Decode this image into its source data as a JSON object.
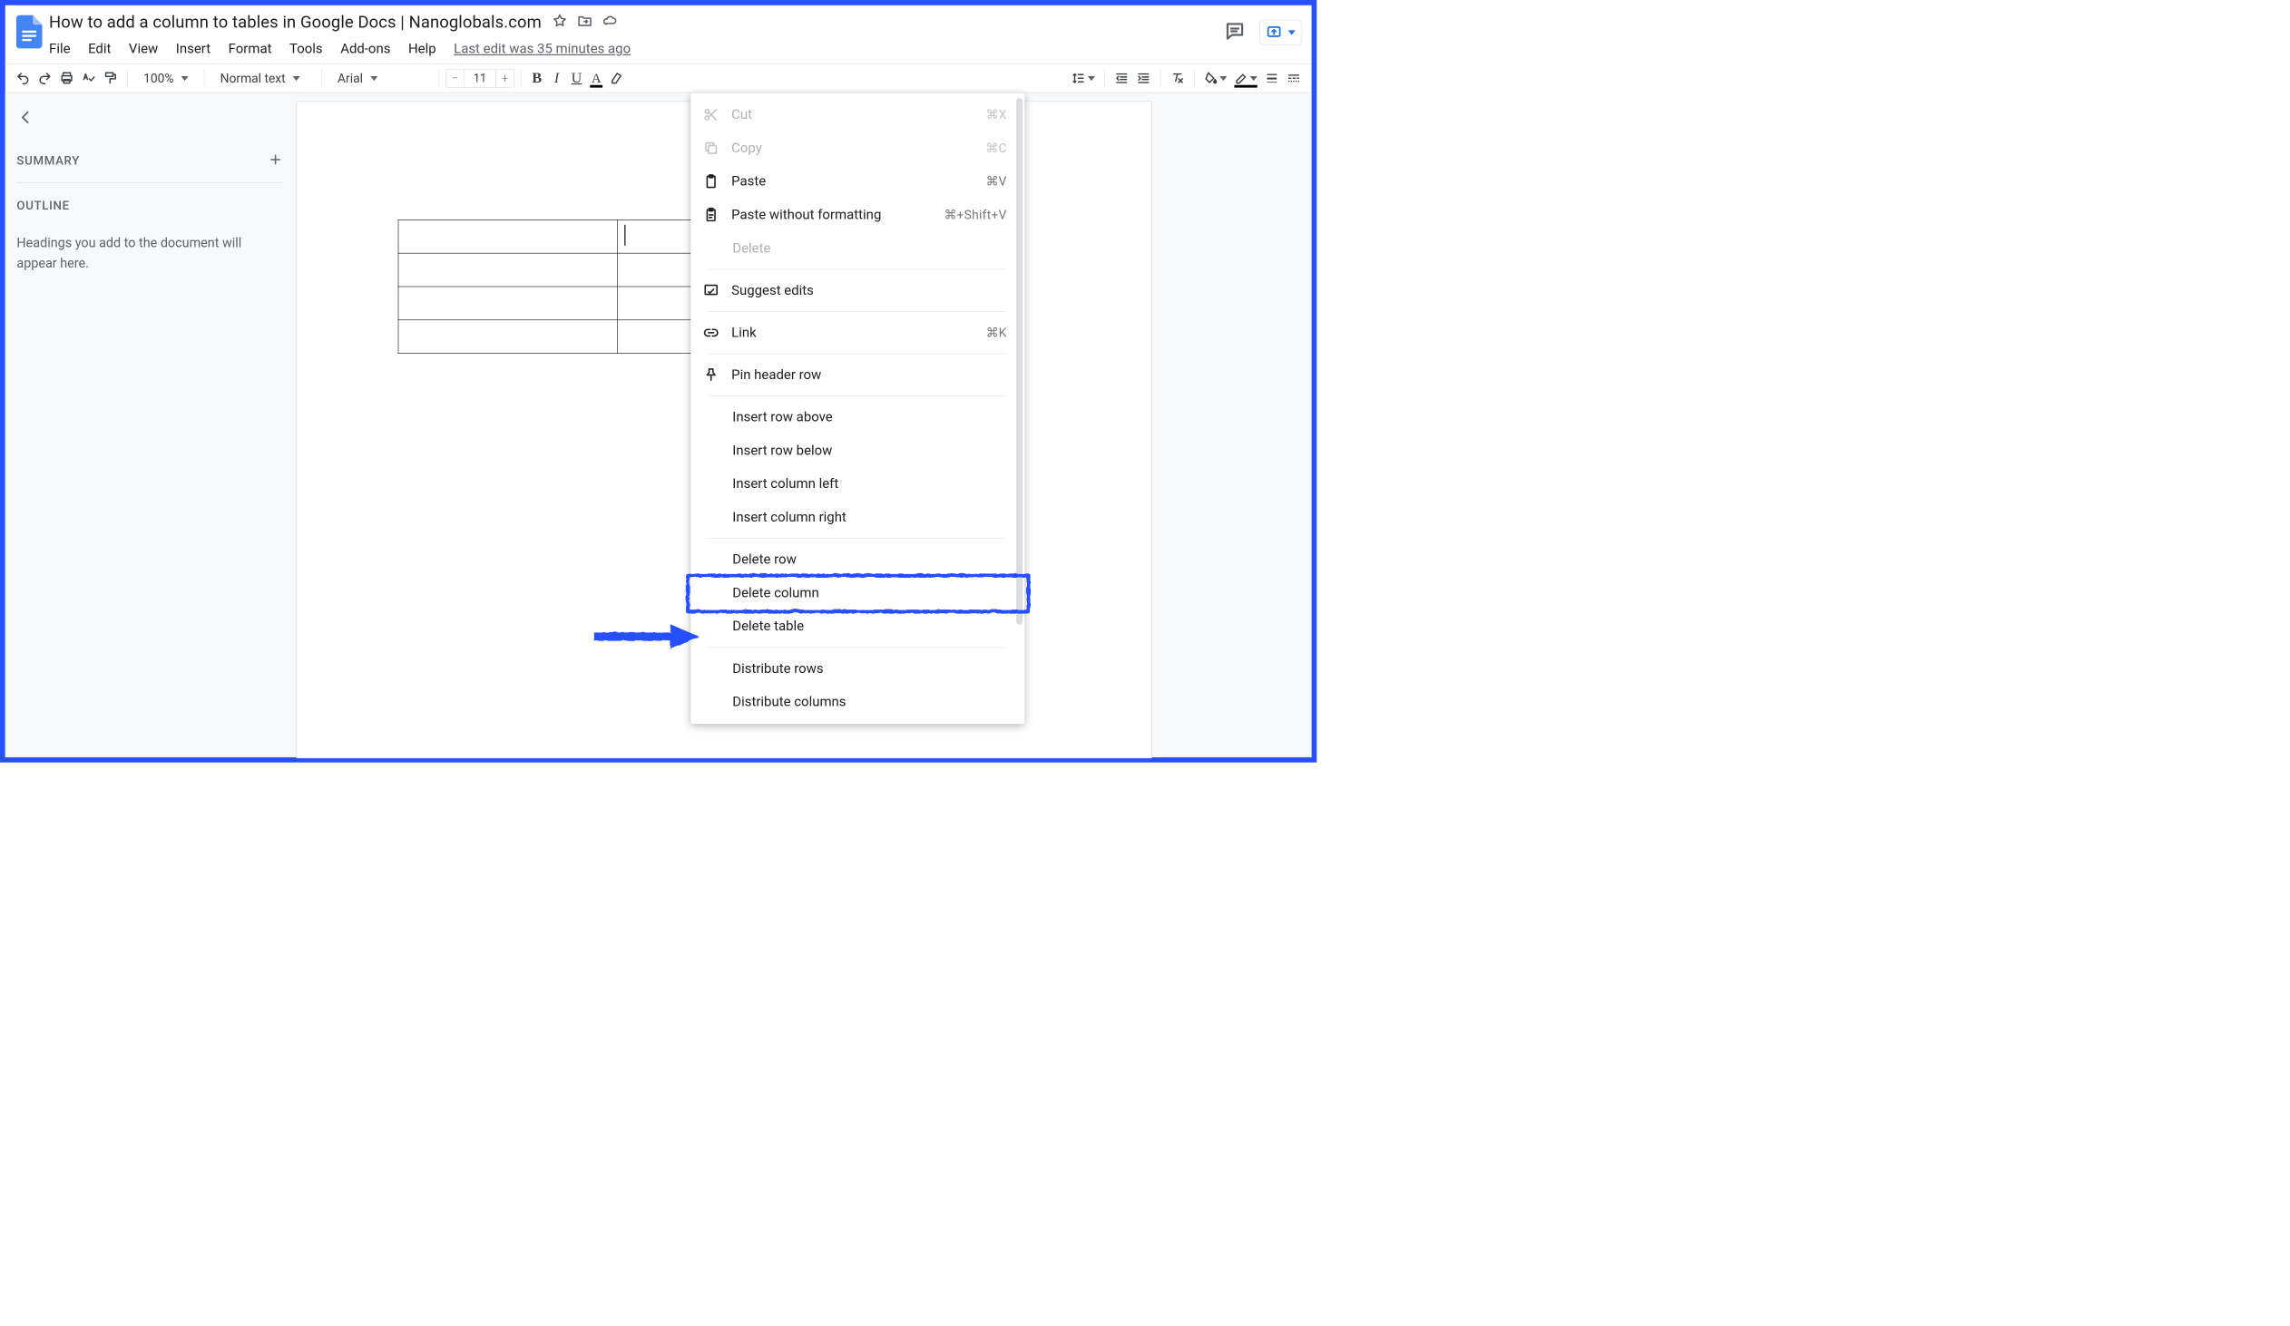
{
  "doc_title": "How to add a column to tables in Google Docs | Nanoglobals.com",
  "menus": [
    "File",
    "Edit",
    "View",
    "Insert",
    "Format",
    "Tools",
    "Add-ons",
    "Help"
  ],
  "last_edit": "Last edit was 35 minutes ago",
  "toolbar": {
    "zoom": "100%",
    "style": "Normal text",
    "font": "Arial",
    "font_size": "11"
  },
  "sidebar": {
    "summary_label": "SUMMARY",
    "outline_label": "OUTLINE",
    "outline_placeholder": "Headings you add to the document will appear here."
  },
  "context_menu": {
    "cut": {
      "label": "Cut",
      "shortcut": "⌘X"
    },
    "copy": {
      "label": "Copy",
      "shortcut": "⌘C"
    },
    "paste": {
      "label": "Paste",
      "shortcut": "⌘V"
    },
    "paste_nofmt": {
      "label": "Paste without formatting",
      "shortcut": "⌘+Shift+V"
    },
    "delete": {
      "label": "Delete"
    },
    "suggest": {
      "label": "Suggest edits"
    },
    "link": {
      "label": "Link",
      "shortcut": "⌘K"
    },
    "pin": {
      "label": "Pin header row"
    },
    "insert_row_above": "Insert row above",
    "insert_row_below": "Insert row below",
    "insert_col_left": "Insert column left",
    "insert_col_right": "Insert column right",
    "delete_row": "Delete row",
    "delete_column": "Delete column",
    "delete_table": "Delete table",
    "distribute_rows": "Distribute rows",
    "distribute_cols": "Distribute columns"
  }
}
